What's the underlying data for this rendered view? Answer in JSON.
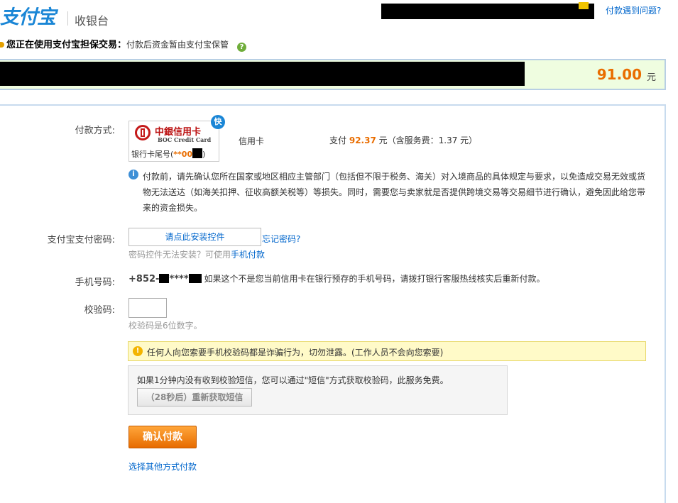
{
  "header": {
    "logo": "支付宝",
    "title": "收银台",
    "help_link": "付款遇到问题?"
  },
  "notice": {
    "label": "您正在使用支付宝担保交易：",
    "desc": "付款后资金暂由支付宝保管",
    "help_icon": "?"
  },
  "order": {
    "amount": "91.00",
    "unit": "元"
  },
  "payment": {
    "method_label": "付款方式:",
    "card_bank_cn": "中銀信用卡",
    "card_bank_en": "BOC Credit Card",
    "card_tail_prefix": "银行卡尾号(",
    "card_tail_value": "**00",
    "card_tail_suffix": ")",
    "fast_badge": "快",
    "card_type": "信用卡",
    "pay_prefix": "支付",
    "pay_amount": "92.37",
    "pay_suffix": "元（含服务费：1.37 元）",
    "info_text": "付款前，请先确认您所在国家或地区相应主管部门（包括但不限于税务、海关）对入境商品的具体规定与要求，以免造成交易无效或货物无法送达（如海关扣押、征收高额关税等）等损失。同时，需要您与卖家就是否提供跨境交易等交易细节进行确认，避免因此给您带来的资金损失。"
  },
  "password": {
    "label": "支付宝支付密码:",
    "install_button": "请点此安装控件",
    "forgot_link": "忘记密码?",
    "hint": "密码控件无法安装？可使用",
    "hint_link": "手机付款"
  },
  "phone": {
    "label": "手机号码:",
    "prefix": "+852-",
    "middle": "****",
    "note": "如果这个不是您当前信用卡在银行预存的手机号码，请拨打银行客服热线核实后重新付款。"
  },
  "verify": {
    "label": "校验码:",
    "hint": "校验码是6位数字。",
    "warning": "任何人向您索要手机校验码都是诈骗行为，切勿泄露。(工作人员不会向您索要)",
    "warning_icon": "!",
    "sms_text": "如果1分钟内没有收到校验短信，您可以通过\"短信\"方式获取校验码，此服务免费。",
    "resend_button": "（28秒后）重新获取短信"
  },
  "actions": {
    "confirm": "确认付款",
    "other_method": "选择其他方式付款"
  },
  "colors": {
    "brand_blue": "#1a86d6",
    "amount_orange": "#e96d00",
    "amount_bar_bg": "#effde0",
    "warning_bg": "#fffac8"
  }
}
